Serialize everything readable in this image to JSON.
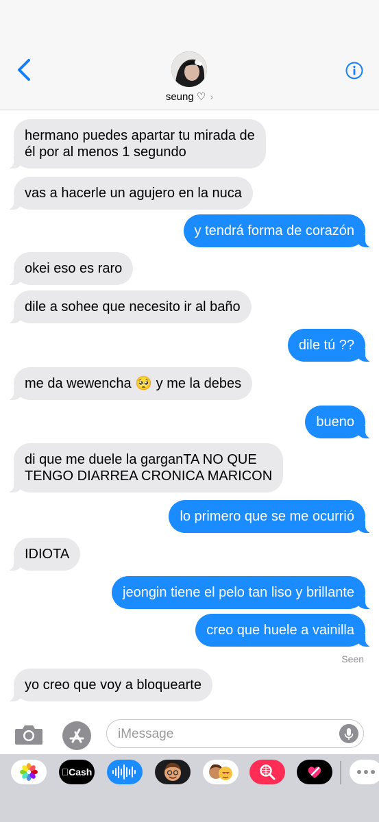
{
  "header": {
    "contact_name": "seung ♡",
    "chevron": "›"
  },
  "messages": [
    {
      "dir": "in",
      "lines": [
        "hermano puedes apartar tu mirada de",
        "él por al menos 1 segundo"
      ]
    },
    {
      "dir": "in",
      "lines": [
        "vas a hacerle un agujero en la nuca"
      ]
    },
    {
      "dir": "out",
      "lines": [
        "y tendrá forma de corazón"
      ]
    },
    {
      "dir": "in",
      "lines": [
        "okei eso es raro"
      ]
    },
    {
      "dir": "in",
      "lines": [
        "dile a sohee que necesito ir al baño"
      ]
    },
    {
      "dir": "out",
      "lines": [
        "dile tú ??"
      ]
    },
    {
      "dir": "in",
      "lines": [
        "me da wewencha 🥺 y me la debes"
      ]
    },
    {
      "dir": "out",
      "lines": [
        "bueno"
      ]
    },
    {
      "dir": "in",
      "lines": [
        "di que me duele la garganTA NO QUE",
        "TENGO DIARREA CRONICA MARICON"
      ]
    },
    {
      "dir": "out",
      "lines": [
        "lo primero que se me ocurrió"
      ]
    },
    {
      "dir": "in",
      "lines": [
        "IDIOTA"
      ]
    },
    {
      "dir": "out",
      "lines": [
        "jeongin tiene el pelo tan liso y brillante"
      ]
    },
    {
      "dir": "out",
      "lines": [
        "creo que huele a vainilla"
      ]
    },
    {
      "dir": "in",
      "lines": [
        "yo creo que voy a bloquearte"
      ]
    }
  ],
  "seen_label": "Seen",
  "input": {
    "placeholder": "iMessage"
  },
  "drawer": {
    "cash_label": "Cash",
    "apps": [
      "photos-icon",
      "apple-cash-icon",
      "audio-message-icon",
      "memoji-icon",
      "animoji-icon",
      "images-search-icon",
      "digital-touch-icon",
      "more-icon"
    ]
  },
  "colors": {
    "outgoing_bubble": "#1a8cff",
    "incoming_bubble": "#e9e9eb",
    "accent": "#147efb"
  }
}
